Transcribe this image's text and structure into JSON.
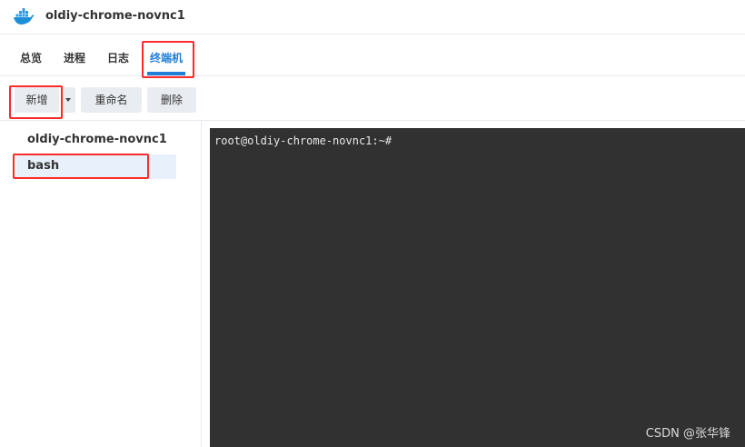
{
  "app": {
    "title": "oldiy-chrome-novnc1",
    "icon": "docker-whale-icon",
    "accent_color": "#1f7fd8"
  },
  "tabs": [
    {
      "label": "总览"
    },
    {
      "label": "进程"
    },
    {
      "label": "日志"
    },
    {
      "label": "终端机",
      "active": true
    }
  ],
  "toolbar": {
    "new_label": "新增",
    "rename_label": "重命名",
    "delete_label": "删除"
  },
  "sidebar": {
    "container_name": "oldiy-chrome-novnc1",
    "sessions": [
      {
        "label": "bash",
        "selected": true
      }
    ]
  },
  "terminal": {
    "prompt": "root@oldiy-chrome-novnc1:~#"
  },
  "watermark": "CSDN @张华锋",
  "highlight_color": "#ff2a2a"
}
